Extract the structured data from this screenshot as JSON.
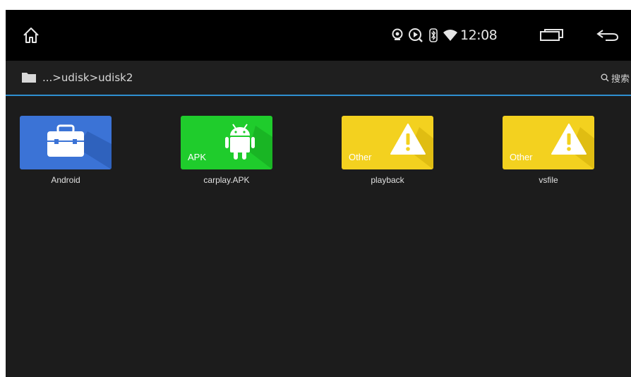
{
  "status_bar": {
    "time": "12:08",
    "icons": [
      "home-icon",
      "location-icon",
      "media-playback-icon",
      "bluetooth-icon",
      "wifi-icon",
      "recent-apps-icon",
      "back-icon"
    ]
  },
  "path_bar": {
    "folder_icon": "folder-icon",
    "path": "...>udisk>udisk2",
    "search_label": "搜索",
    "search_icon": "search-icon"
  },
  "files": [
    {
      "name": "Android",
      "type_label": "",
      "icon": "toolbox-icon",
      "color": "#3b73d6"
    },
    {
      "name": "carplay.APK",
      "type_label": "APK",
      "icon": "android-robot-icon",
      "color": "#1fcc2c"
    },
    {
      "name": "playback",
      "type_label": "Other",
      "icon": "warning-triangle-icon",
      "color": "#f3d11f"
    },
    {
      "name": "vsfile",
      "type_label": "Other",
      "icon": "warning-triangle-icon",
      "color": "#f3d11f"
    }
  ],
  "colors": {
    "status_bar_bg": "#000000",
    "content_bg": "#1c1c1c",
    "accent_line": "#2f8fd0"
  }
}
